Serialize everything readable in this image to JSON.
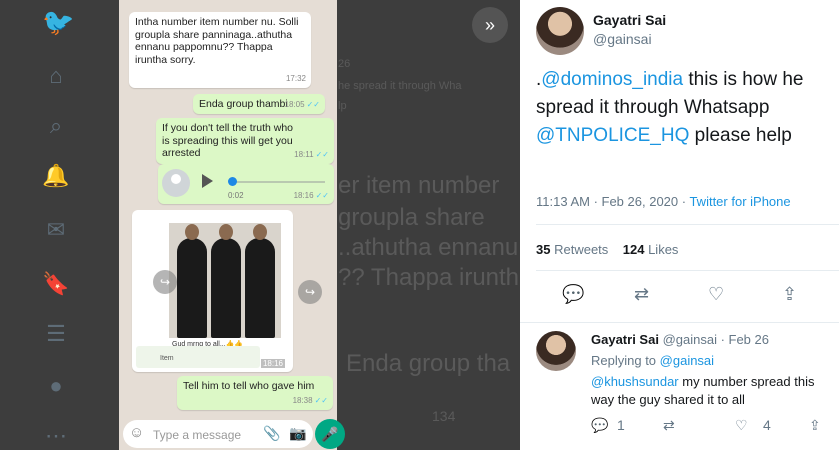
{
  "lightbox": {
    "next_icon": "double-chevron-right-icon"
  },
  "background": {
    "ghost_texts": [
      "26",
      "he spread it through Wha",
      "lp",
      "er item number",
      "groupla share",
      "..athutha ennanu",
      "?? Thappa iruntha",
      "Enda group tha",
      "134"
    ]
  },
  "whatsapp": {
    "messages": [
      {
        "text": "Intha number item number nu. Solli groupla share panninaga..athutha ennanu pappomnu?? Thappa iruntha sorry.",
        "time": "17:32"
      },
      {
        "text": "Enda group thambi",
        "time": "18:05",
        "ticks": "✓✓"
      },
      {
        "text": "If you don't tell the truth who is spreading this will get you arrested",
        "time": "18:11",
        "ticks": "✓✓"
      },
      {
        "text": "Tell him to tell who gave him",
        "time": "18:38",
        "ticks": "✓✓"
      }
    ],
    "voice": {
      "duration": "0:02",
      "time": "18:16",
      "ticks": "✓✓"
    },
    "media": {
      "caption": "Gud mrng to all...👍👍",
      "time": "18:16",
      "item_label": "Item"
    },
    "composer": {
      "placeholder": "Type a message"
    }
  },
  "tweet": {
    "name": "Gayatri Sai",
    "handle": "@gainsai",
    "text_prefix": ".",
    "mention1": "@dominos_india",
    "text_middle": " this is how he spread it through Whatsapp ",
    "mention2": "@TNPOLICE_HQ",
    "text_suffix": " please help",
    "timestamp": "11:13 AM · Feb 26, 2020 · ",
    "source": "Twitter for iPhone",
    "retweets_count": "35",
    "retweets_label": "Retweets",
    "likes_count": "124",
    "likes_label": "Likes"
  },
  "reply": {
    "name": "Gayatri Sai",
    "handle_date": "@gainsai · Feb 26",
    "replying_prefix": "Replying to ",
    "replying_to": "@gainsai",
    "mention": "@khushsundar",
    "text": "  my number spread this way the guy shared it to all",
    "reply_count": "1",
    "like_count": "4"
  }
}
